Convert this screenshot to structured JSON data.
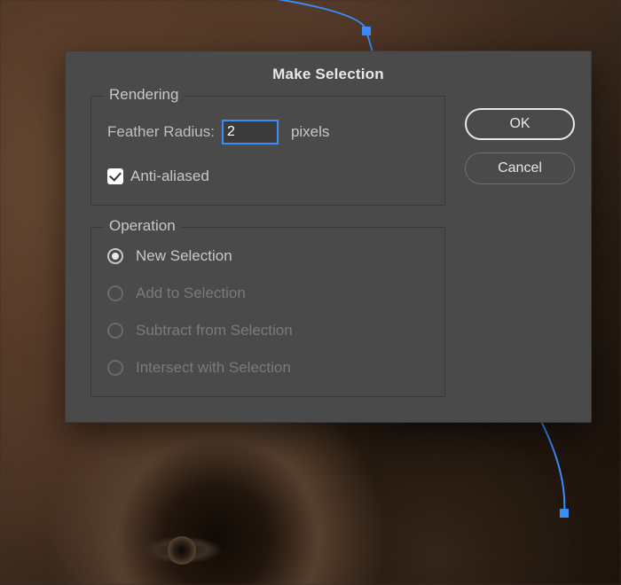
{
  "dialog": {
    "title": "Make Selection",
    "rendering": {
      "legend": "Rendering",
      "feather_label": "Feather Radius:",
      "feather_value": "2",
      "feather_unit": "pixels",
      "anti_aliased_label": "Anti-aliased",
      "anti_aliased_checked": true
    },
    "operation": {
      "legend": "Operation",
      "options": [
        {
          "label": "New Selection",
          "selected": true,
          "enabled": true
        },
        {
          "label": "Add to Selection",
          "selected": false,
          "enabled": false
        },
        {
          "label": "Subtract from Selection",
          "selected": false,
          "enabled": false
        },
        {
          "label": "Intersect with Selection",
          "selected": false,
          "enabled": false
        }
      ]
    },
    "buttons": {
      "ok": "OK",
      "cancel": "Cancel"
    }
  },
  "colors": {
    "dialog_bg": "#4a4a4a",
    "accent": "#3b8cff",
    "text": "#c8c8c8",
    "disabled_text": "#7a7a7a"
  }
}
